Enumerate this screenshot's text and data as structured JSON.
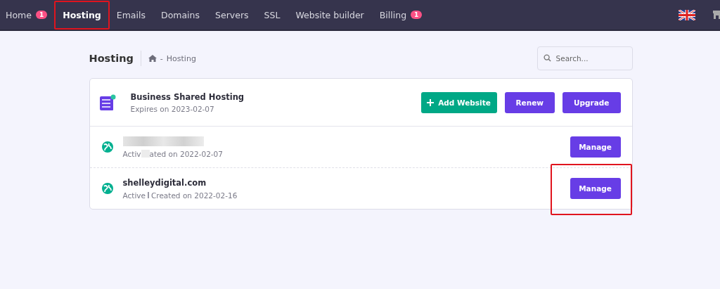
{
  "nav": {
    "items": [
      {
        "label": "Home",
        "badge": "1",
        "selected": false,
        "annotated": false
      },
      {
        "label": "Hosting",
        "selected": true,
        "annotated": true
      },
      {
        "label": "Emails",
        "selected": false,
        "annotated": false
      },
      {
        "label": "Domains",
        "selected": false,
        "annotated": false
      },
      {
        "label": "Servers",
        "selected": false,
        "annotated": false
      },
      {
        "label": "SSL",
        "selected": false,
        "annotated": false
      },
      {
        "label": "Website builder",
        "selected": false,
        "annotated": false
      },
      {
        "label": "Billing",
        "badge": "1",
        "selected": false,
        "annotated": false
      }
    ]
  },
  "header": {
    "title": "Hosting",
    "breadcrumb_separator": "-",
    "breadcrumb": "Hosting",
    "search": {
      "placeholder": "Search..."
    }
  },
  "plan": {
    "name": "Business Shared Hosting",
    "expiry": "Expires on 2023-02-07",
    "buttons": [
      {
        "label": "Add Website",
        "kind": "add"
      },
      {
        "label": "Renew",
        "kind": "primary"
      },
      {
        "label": "Upgrade",
        "kind": "primary"
      }
    ]
  },
  "websites": [
    {
      "redacted": true,
      "status": "Activ",
      "created": "ated on 2022-02-07",
      "button": "Manage",
      "annotated": false
    },
    {
      "redacted": false,
      "domain": "shelleydigital.com",
      "status": "Active",
      "created": "Created on 2022-02-16",
      "button": "Manage",
      "annotated": true
    }
  ]
}
